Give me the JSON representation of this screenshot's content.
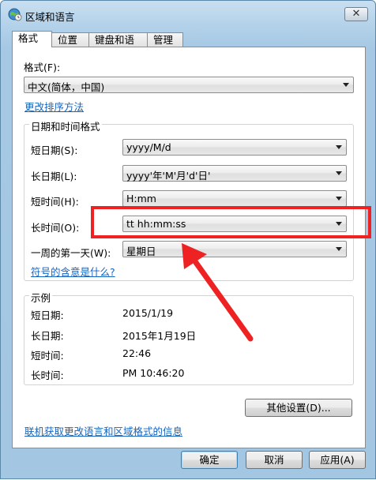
{
  "window": {
    "title": "区域和语言",
    "close_glyph": "✕"
  },
  "tabs": [
    "格式",
    "位置",
    "键盘和语言",
    "管理"
  ],
  "format": {
    "label": "格式(F):",
    "value": "中文(简体，中国)"
  },
  "sort_link": "更改排序方法",
  "datetime_group": {
    "title": "日期和时间格式",
    "rows": [
      {
        "label": "短日期(S):",
        "value": "yyyy/M/d"
      },
      {
        "label": "长日期(L):",
        "value": "yyyy'年'M'月'd'日'"
      },
      {
        "label": "短时间(H):",
        "value": "H:mm"
      },
      {
        "label": "长时间(O):",
        "value": "tt hh:mm:ss"
      },
      {
        "label": "一周的第一天(W):",
        "value": "星期日"
      }
    ],
    "symbols_link": "符号的含意是什么?"
  },
  "example_group": {
    "title": "示例",
    "rows": [
      {
        "label": "短日期:",
        "value": "2015/1/19"
      },
      {
        "label": "长日期:",
        "value": "2015年1月19日"
      },
      {
        "label": "短时间:",
        "value": "22:46"
      },
      {
        "label": "长时间:",
        "value": "PM 10:46:20"
      }
    ]
  },
  "other_settings_button": "其他设置(D)...",
  "online_link": "联机获取更改语言和区域格式的信息",
  "buttons": {
    "ok": "确定",
    "cancel": "取消",
    "apply": "应用(A)"
  },
  "colors": {
    "annotation": "#ee2222",
    "link": "#1565c0"
  }
}
